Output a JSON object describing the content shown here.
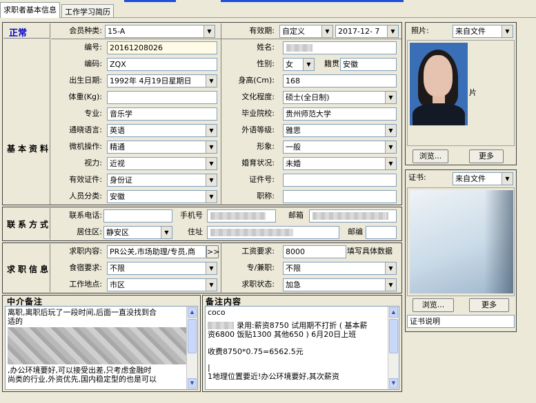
{
  "tabs": [
    {
      "label": "求职者基本信息",
      "active": true
    },
    {
      "label": "工作学习简历",
      "active": false
    }
  ],
  "status": {
    "text": "正常",
    "color": "#0000cc"
  },
  "header": {
    "member_type_label": "会员种类:",
    "member_type_value": "15-A",
    "validity_label": "有效期:",
    "validity_mode": "自定义",
    "validity_date": "2017-12- 7"
  },
  "basic": {
    "section_label": "基本资料",
    "id_label": "编号:",
    "id_value": "20161208026",
    "name_label": "姓名:",
    "name_value": "",
    "code_label": "编码:",
    "code_value": "ZQX",
    "gender_label": "性别:",
    "gender_value": "女",
    "native_label": "籍贯",
    "native_value": "安徽",
    "birth_label": "出生日期:",
    "birth_value": "1992年 4月19日星期日",
    "height_label": "身高(Cm):",
    "height_value": "168",
    "weight_label": "体重(Kg):",
    "weight_value": "",
    "education_label": "文化程度:",
    "education_value": "硕士(全日制)",
    "major_label": "专业:",
    "major_value": "音乐学",
    "school_label": "毕业院校:",
    "school_value": "贵州师范大学",
    "language_label": "通晓语言:",
    "language_value": "英语",
    "language_level_label": "外语等级:",
    "language_level_value": "雅思",
    "computer_label": "微机操作:",
    "computer_value": "精通",
    "image_label": "形象:",
    "image_value": "一般",
    "vision_label": "视力:",
    "vision_value": "近视",
    "marital_label": "婚育状况:",
    "marital_value": "未婚",
    "idtype_label": "有效证件:",
    "idtype_value": "身份证",
    "idno_label": "证件号:",
    "idno_value": "",
    "category_label": "人员分类:",
    "category_value": "安徽",
    "title_label": "职称:",
    "title_value": ""
  },
  "contact": {
    "section_label": "联系方式",
    "phone_label": "联系电话:",
    "phone_value": "",
    "mobile_label": "手机号",
    "mobile_value": "",
    "email_label": "邮箱",
    "email_value": "",
    "district_label": "居住区:",
    "district_value": "静安区",
    "address_label": "住址",
    "address_value": "",
    "postcode_label": "邮编",
    "postcode_value": ""
  },
  "job": {
    "section_label": "求职信息",
    "content_label": "求职内容:",
    "content_value": "PR公关,市场助理/专员,商",
    "more_button": ">>",
    "salary_label": "工资要求:",
    "salary_value": "8000",
    "salary_hint": "填写具体数据",
    "board_label": "食宿要求:",
    "board_value": "不限",
    "parttime_label": "专/兼职:",
    "parttime_value": "不限",
    "location_label": "工作地点:",
    "location_value": "市区",
    "state_label": "求职状态:",
    "state_value": "加急"
  },
  "agent_notes": {
    "title": "中介备注",
    "line1": "离职,离职后玩了一段时间,后面一直没找到合",
    "line2": "适的",
    "line3": ",办公环境要好,可以接受出差,只考虑金融时",
    "line4": "尚类的行业,外资优先,国内稳定型的也是可以"
  },
  "remarks": {
    "title": "备注内容",
    "line1": "coco",
    "line2": "录用:薪资8750 试用期不打折 ( 基本薪",
    "line3": "资6800 饭贴1300 其他650 ) 6月20日上班",
    "line4": "收费8750*0.75=6562.5元",
    "line5": "|",
    "line6": "1地理位置要近!办公环境要好,其次薪资"
  },
  "photo": {
    "label": "照片:",
    "source": "来自文件",
    "side_char": "片",
    "browse_button": "浏览...",
    "more_button": "更多"
  },
  "certificate": {
    "label": "证书:",
    "source": "来自文件",
    "browse_button": "浏览...",
    "more_button": "更多",
    "caption": "证书说明"
  }
}
